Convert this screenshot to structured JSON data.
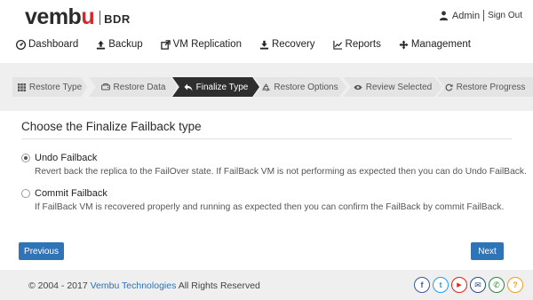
{
  "header": {
    "logo_main": "vembu",
    "logo_sub": "BDR",
    "user": "Admin",
    "signout": "Sign Out"
  },
  "nav": {
    "items": [
      {
        "label": "Dashboard",
        "icon": "dashboard-icon"
      },
      {
        "label": "Backup",
        "icon": "upload-icon"
      },
      {
        "label": "VM Replication",
        "icon": "external-link-icon"
      },
      {
        "label": "Recovery",
        "icon": "download-icon"
      },
      {
        "label": "Reports",
        "icon": "line-chart-icon"
      },
      {
        "label": "Management",
        "icon": "move-icon"
      }
    ]
  },
  "wizard": {
    "steps": [
      {
        "label": "Restore Type",
        "icon": "grid-icon",
        "active": false
      },
      {
        "label": "Restore Data",
        "icon": "hdd-icon",
        "active": false
      },
      {
        "label": "Finalize Type",
        "icon": "reply-icon",
        "active": true
      },
      {
        "label": "Restore Options",
        "icon": "recycle-icon",
        "active": false
      },
      {
        "label": "Review Selected",
        "icon": "eye-icon",
        "active": false
      },
      {
        "label": "Restore Progress",
        "icon": "refresh-icon",
        "active": false
      }
    ]
  },
  "content": {
    "title": "Choose the Finalize Failback type",
    "options": [
      {
        "label": "Undo Failback",
        "description": "Revert back the replica to the FailOver state. If FailBack VM is not performing as expected then you can do Undo FailBack.",
        "selected": true
      },
      {
        "label": "Commit Failback",
        "description": "If FailBack VM is recovered properly and running as expected then you can confirm the FailBack by commit FailBack.",
        "selected": false
      }
    ]
  },
  "buttons": {
    "previous": "Previous",
    "next": "Next"
  },
  "footer": {
    "copyright_prefix": "© 2004 - 2017",
    "company": "Vembu Technologies",
    "rights": "All Rights Reserved",
    "socials": [
      {
        "name": "facebook-icon",
        "glyph": "f",
        "color": "#3b5998"
      },
      {
        "name": "twitter-icon",
        "glyph": "t",
        "color": "#1da1f2"
      },
      {
        "name": "youtube-icon",
        "glyph": "▶",
        "color": "#e62117"
      },
      {
        "name": "email-icon",
        "glyph": "✉",
        "color": "#2a4a8a"
      },
      {
        "name": "phone-icon",
        "glyph": "✆",
        "color": "#2a8a3a"
      },
      {
        "name": "help-icon",
        "glyph": "?",
        "color": "#e8a317"
      }
    ]
  },
  "colors": {
    "accent": "#3074b8",
    "active_step": "#2e2e2e",
    "brand_red": "#d6262b"
  }
}
